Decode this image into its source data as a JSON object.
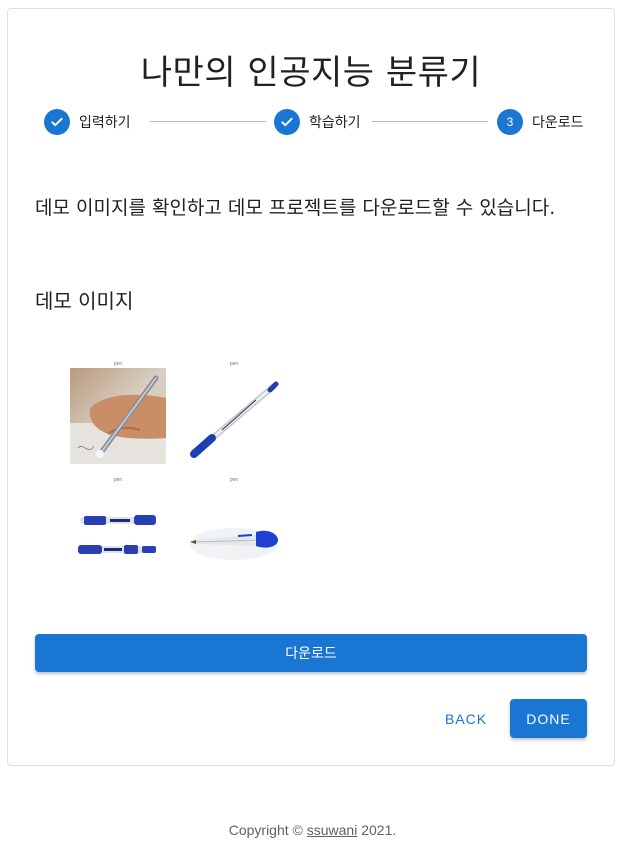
{
  "title": "나만의 인공지능 분류기",
  "stepper": {
    "steps": [
      {
        "label": "입력하기",
        "state": "completed",
        "icon": "check-icon"
      },
      {
        "label": "학습하기",
        "state": "completed",
        "icon": "check-icon"
      },
      {
        "label": "다운로드",
        "state": "active",
        "number": "3"
      }
    ]
  },
  "description": "데모 이미지를 확인하고 데모 프로젝트를 다운로드할 수 있습니다.",
  "demo": {
    "heading": "데모 이미지",
    "images": [
      {
        "caption": "pen",
        "subject": "hand-writing-with-pen"
      },
      {
        "caption": "pen",
        "subject": "blue-ballpoint-pen"
      },
      {
        "caption": "pen",
        "subject": "two-gel-pens"
      },
      {
        "caption": "pen",
        "subject": "ballpoint-pen-closeup"
      }
    ]
  },
  "buttons": {
    "download": "다운로드",
    "back": "BACK",
    "done": "DONE"
  },
  "footer": {
    "prefix": "Copyright © ",
    "link": "ssuwani",
    "suffix": " 2021."
  },
  "colors": {
    "primary": "#1976d2",
    "connector": "#bdbdbd",
    "text": "#212121"
  }
}
